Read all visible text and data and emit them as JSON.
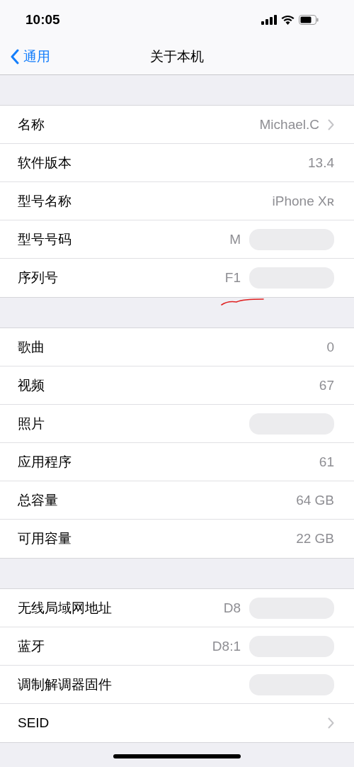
{
  "status_bar": {
    "time": "10:05"
  },
  "nav": {
    "back": "通用",
    "title": "关于本机"
  },
  "sections": [
    {
      "rows": [
        {
          "label": "名称",
          "value": "Michael.C",
          "disclosure": true,
          "redacted": false
        },
        {
          "label": "软件版本",
          "value": "13.4",
          "disclosure": false,
          "redacted": false
        },
        {
          "label": "型号名称",
          "value": "iPhone Xʀ",
          "disclosure": false,
          "redacted": false
        },
        {
          "label": "型号号码",
          "value": "M",
          "disclosure": false,
          "redacted": true
        },
        {
          "label": "序列号",
          "value": "F1",
          "disclosure": false,
          "redacted": true,
          "underlined": true
        }
      ]
    },
    {
      "rows": [
        {
          "label": "歌曲",
          "value": "0",
          "disclosure": false,
          "redacted": false
        },
        {
          "label": "视频",
          "value": "67",
          "disclosure": false,
          "redacted": false
        },
        {
          "label": "照片",
          "disclosure": false,
          "redacted": true
        },
        {
          "label": "应用程序",
          "value": "61",
          "disclosure": false,
          "redacted": false
        },
        {
          "label": "总容量",
          "value": "64 GB",
          "disclosure": false,
          "redacted": false
        },
        {
          "label": "可用容量",
          "value": "22 GB",
          "disclosure": false,
          "redacted": false
        }
      ]
    },
    {
      "rows": [
        {
          "label": "无线局域网地址",
          "value": "D8",
          "disclosure": false,
          "redacted": true
        },
        {
          "label": "蓝牙",
          "value": "D8:1",
          "disclosure": false,
          "redacted": true
        },
        {
          "label": "调制解调器固件",
          "disclosure": false,
          "redacted": true
        },
        {
          "label": "SEID",
          "disclosure": true,
          "redacted": false
        }
      ]
    }
  ]
}
